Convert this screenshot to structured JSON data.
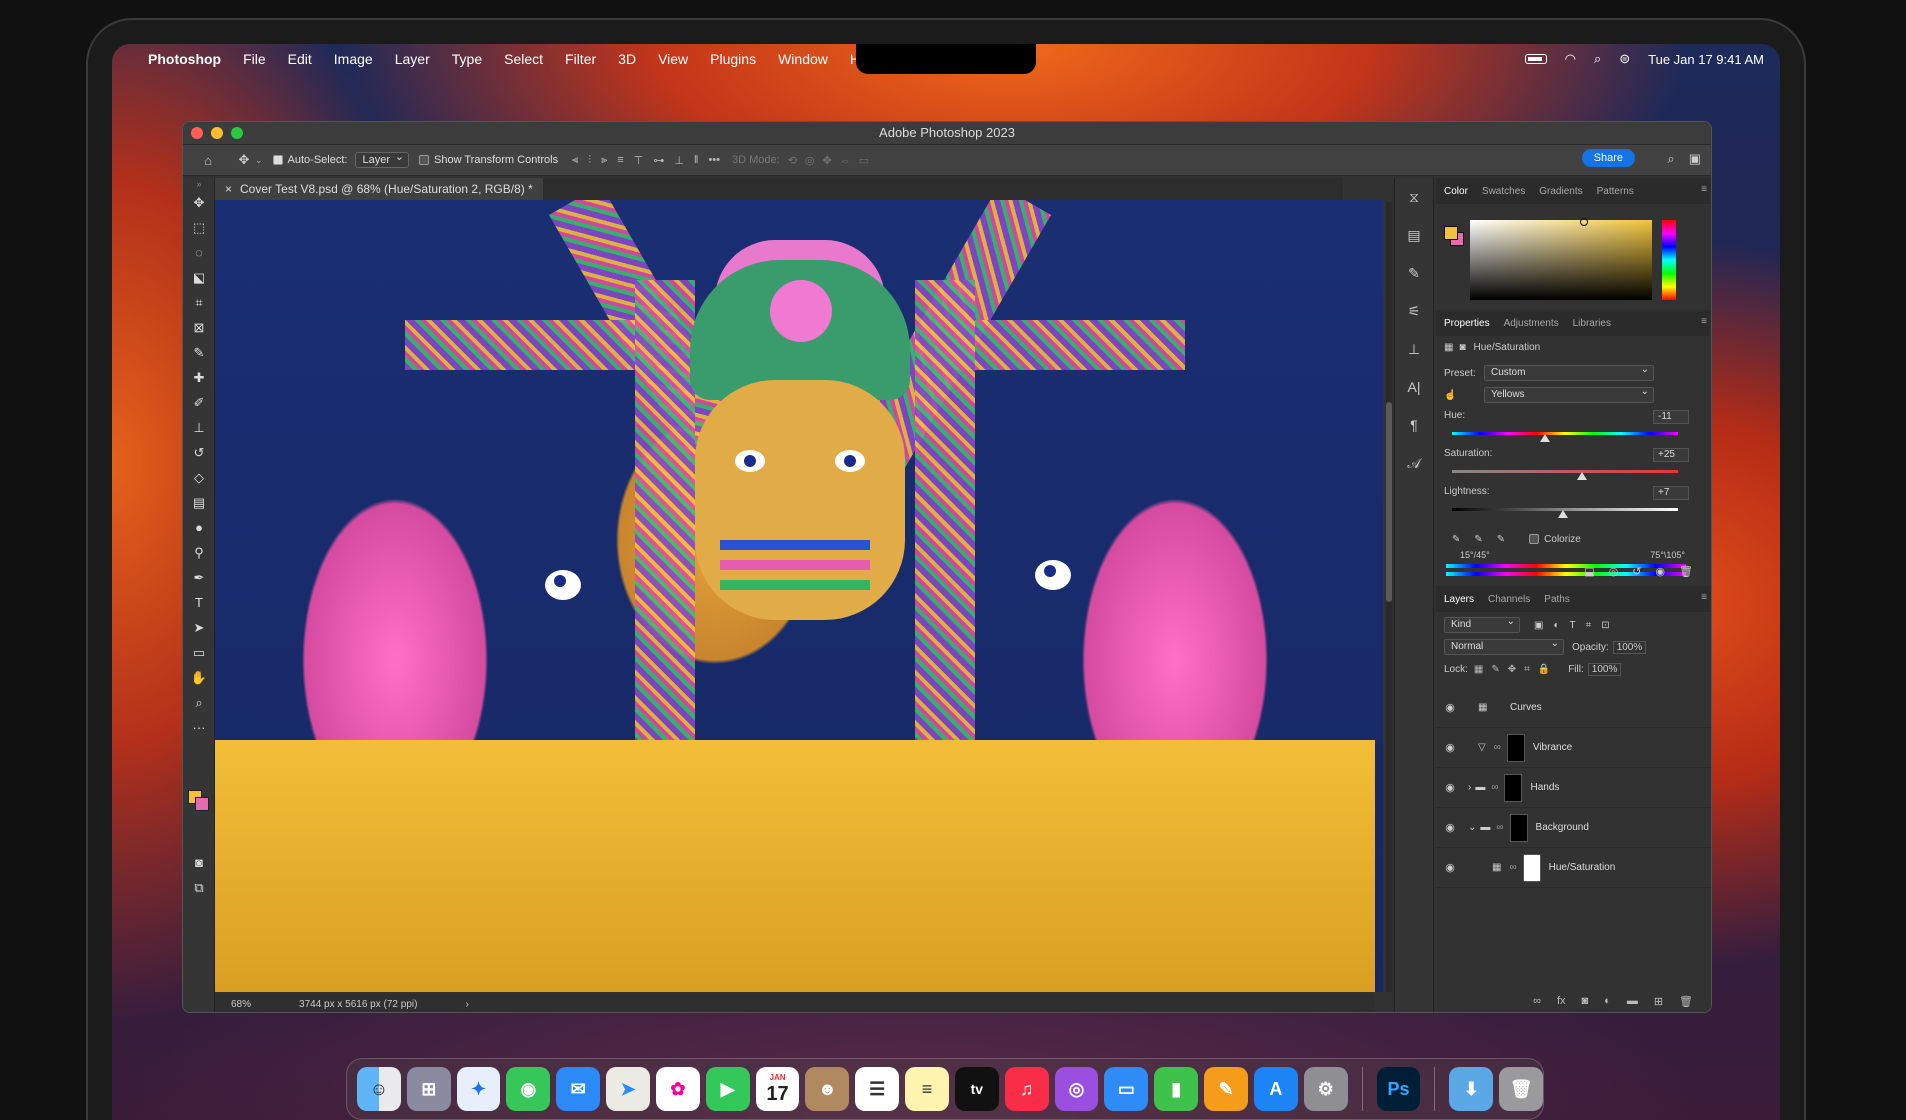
{
  "menubar": {
    "app": "Photoshop",
    "items": [
      "File",
      "Edit",
      "Image",
      "Layer",
      "Type",
      "Select",
      "Filter",
      "3D",
      "View",
      "Plugins",
      "Window",
      "Help"
    ],
    "clock": "Tue Jan 17  9:41 AM"
  },
  "window": {
    "title": "Adobe Photoshop 2023",
    "options": {
      "auto_select_label": "Auto-Select:",
      "auto_select_value": "Layer",
      "transform_label": "Show Transform Controls",
      "mode_label": "3D Mode:",
      "share_label": "Share"
    },
    "doc_tab": "Cover Test V8.psd @ 68% (Hue/Saturation 2, RGB/8) *",
    "status": {
      "zoom": "68%",
      "info": "3744 px x 5616 px (72 ppi)"
    }
  },
  "color_panel": {
    "tabs": [
      "Color",
      "Swatches",
      "Gradients",
      "Patterns"
    ],
    "fg": "#f3c23c",
    "bg": "#e66ab1"
  },
  "properties_panel": {
    "tabs": [
      "Properties",
      "Adjustments",
      "Libraries"
    ],
    "type": "Hue/Saturation",
    "preset_label": "Preset:",
    "preset_value": "Custom",
    "channel_value": "Yellows",
    "hue_label": "Hue:",
    "hue_value": "-11",
    "sat_label": "Saturation:",
    "sat_value": "+25",
    "light_label": "Lightness:",
    "light_value": "+7",
    "colorize_label": "Colorize",
    "range_left": "15°/45°",
    "range_right": "75°\\105°"
  },
  "layers_panel": {
    "tabs": [
      "Layers",
      "Channels",
      "Paths"
    ],
    "kind": "Kind",
    "blend": "Normal",
    "opacity_label": "Opacity:",
    "opacity_value": "100%",
    "lock_label": "Lock:",
    "fill_label": "Fill:",
    "fill_value": "100%",
    "layers": [
      {
        "name": "Curves"
      },
      {
        "name": "Vibrance"
      },
      {
        "name": "Hands"
      },
      {
        "name": "Background"
      },
      {
        "name": "Hue/Saturation"
      }
    ]
  },
  "dock": {
    "calendar_month": "JAN",
    "calendar_day": "17",
    "tv_label": "tv",
    "ps_label": "Ps"
  }
}
